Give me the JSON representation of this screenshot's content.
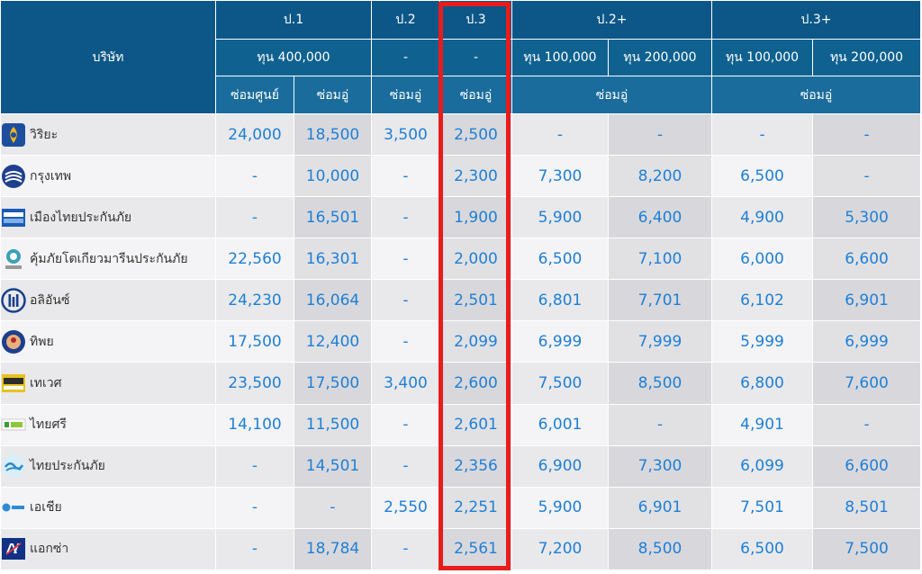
{
  "header": {
    "company": "บริษัท",
    "groups": [
      "ป.1",
      "ป.2",
      "ป.3",
      "ป.2+",
      "ป.3+"
    ],
    "coverage": [
      "ทุน 400,000",
      "-",
      "-",
      "ทุน 100,000",
      "ทุน 200,000",
      "ทุน 100,000",
      "ทุน 200,000"
    ],
    "repair": [
      "ซ่อมศูนย์",
      "ซ่อมอู่",
      "ซ่อมอู่",
      "ซ่อมอู่",
      "ซ่อมอู่",
      "ซ่อมอู่"
    ]
  },
  "rows": [
    {
      "company": "วิริยะ",
      "logo": "viriyah-logo",
      "values": [
        "24,000",
        "18,500",
        "3,500",
        "2,500",
        "-",
        "-",
        "-",
        "-"
      ]
    },
    {
      "company": "กรุงเทพ",
      "logo": "bangkok-insurance-logo",
      "values": [
        "-",
        "10,000",
        "-",
        "2,300",
        "7,300",
        "8,200",
        "6,500",
        "-"
      ]
    },
    {
      "company": "เมืองไทยประกันภัย",
      "logo": "muangthai-logo",
      "values": [
        "-",
        "16,501",
        "-",
        "1,900",
        "5,900",
        "6,400",
        "4,900",
        "5,300"
      ]
    },
    {
      "company": "คุ้มภัยโตเกียวมารีนประกันภัย",
      "logo": "tokio-marine-logo",
      "values": [
        "22,560",
        "16,301",
        "-",
        "2,000",
        "6,500",
        "7,100",
        "6,000",
        "6,600"
      ]
    },
    {
      "company": "อลิอันซ์",
      "logo": "allianz-logo",
      "values": [
        "24,230",
        "16,064",
        "-",
        "2,501",
        "6,801",
        "7,701",
        "6,102",
        "6,901"
      ]
    },
    {
      "company": "ทิพย",
      "logo": "dhipaya-logo",
      "values": [
        "17,500",
        "12,400",
        "-",
        "2,099",
        "6,999",
        "7,999",
        "5,999",
        "6,999"
      ]
    },
    {
      "company": "เทเวศ",
      "logo": "deves-logo",
      "values": [
        "23,500",
        "17,500",
        "3,400",
        "2,600",
        "7,500",
        "8,500",
        "6,800",
        "7,600"
      ]
    },
    {
      "company": "ไทยศรี",
      "logo": "thaisri-logo",
      "values": [
        "14,100",
        "11,500",
        "-",
        "2,601",
        "6,001",
        "-",
        "4,901",
        "-"
      ]
    },
    {
      "company": "ไทยประกันภัย",
      "logo": "thai-insurance-logo",
      "values": [
        "-",
        "14,501",
        "-",
        "2,356",
        "6,900",
        "7,300",
        "6,099",
        "6,600"
      ]
    },
    {
      "company": "เอเชีย",
      "logo": "asia-insurance-logo",
      "values": [
        "-",
        "-",
        "2,550",
        "2,251",
        "5,900",
        "6,901",
        "7,501",
        "8,501"
      ]
    },
    {
      "company": "แอกซ่า",
      "logo": "axa-logo",
      "values": [
        "-",
        "18,784",
        "-",
        "2,561",
        "7,200",
        "8,500",
        "6,500",
        "7,500"
      ]
    }
  ],
  "colors": {
    "header": "#0c5787",
    "value_text": "#1e7fd6",
    "highlight": "#e81c1c"
  }
}
